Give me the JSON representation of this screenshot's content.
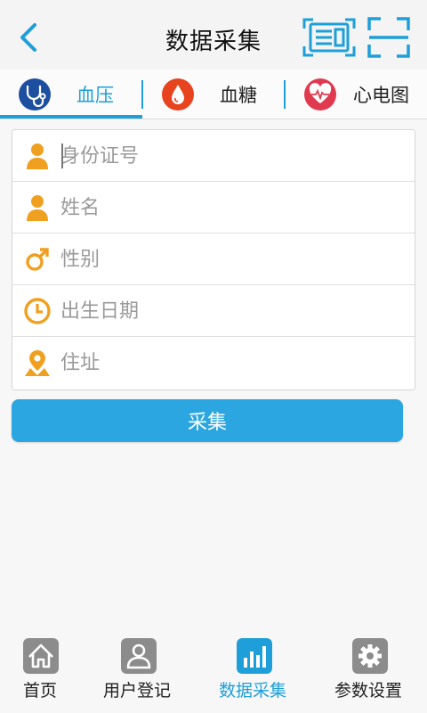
{
  "header": {
    "title": "数据采集",
    "back_icon": "chevron-left-icon",
    "id_card_icon": "id-card-reader-icon",
    "scan_icon": "scan-frame-icon"
  },
  "tabs": [
    {
      "label": "血压",
      "icon": "stethoscope-icon",
      "active": true
    },
    {
      "label": "血糖",
      "icon": "blood-drop-icon",
      "active": false
    },
    {
      "label": "心电图",
      "icon": "heart-pulse-icon",
      "active": false
    }
  ],
  "form": {
    "id_number": {
      "placeholder": "身份证号",
      "value": "",
      "icon": "person-icon"
    },
    "name": {
      "placeholder": "姓名",
      "value": "",
      "icon": "person-icon"
    },
    "gender": {
      "placeholder": "性别",
      "value": "",
      "icon": "male-symbol-icon"
    },
    "birth_date": {
      "placeholder": "出生日期",
      "value": "",
      "icon": "clock-icon"
    },
    "address": {
      "placeholder": "住址",
      "value": "",
      "icon": "location-pin-icon"
    }
  },
  "collect_button": {
    "label": "采集"
  },
  "bottom_nav": [
    {
      "label": "首页",
      "icon": "home-icon",
      "active": false
    },
    {
      "label": "用户登记",
      "icon": "user-icon",
      "active": false
    },
    {
      "label": "数据采集",
      "icon": "bar-chart-icon",
      "active": true
    },
    {
      "label": "参数设置",
      "icon": "gear-icon",
      "active": false
    }
  ],
  "colors": {
    "accent": "#1e9fd9",
    "button": "#2ca6e0",
    "form_icon": "#f0a020",
    "nav_icon_inactive": "#8c8c8c",
    "blood_drop": "#e8431f",
    "heart_badge": "#e03a50",
    "stethoscope_badge": "#1d4fa0"
  }
}
